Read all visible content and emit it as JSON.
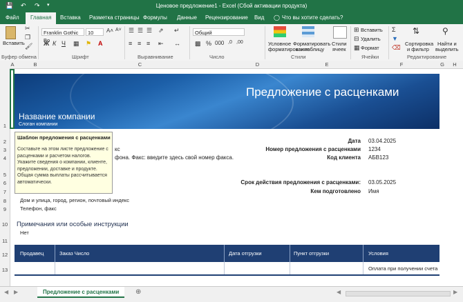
{
  "window": {
    "title": "Ценовое предложение1 - Excel (Сбой активации продукта)"
  },
  "tabs": {
    "file": "Файл",
    "home": "Главная",
    "insert": "Вставка",
    "layout": "Разметка страницы",
    "formulas": "Формулы",
    "data": "Данные",
    "review": "Рецензирование",
    "view": "Вид",
    "tellme": "Что вы хотите сделать?"
  },
  "ribbon": {
    "paste": "Вставить",
    "clipboard": "Буфер обмена",
    "font_name": "Franklin Gothic Bo",
    "font_size": "10",
    "font": "Шрифт",
    "alignment": "Выравнивание",
    "number_format": "Общий",
    "number": "Число",
    "conditional": "Условное",
    "conditional2": "форматирование",
    "format_table": "Форматировать",
    "format_table2": "как таблицу",
    "cell_styles": "Стили",
    "cell_styles2": "ячеек",
    "styles": "Стили",
    "insert": "Вставить",
    "delete": "Удалить",
    "format": "Формат",
    "cells": "Ячейки",
    "sort": "Сортировка",
    "sort2": "и фильтр",
    "find": "Найти и",
    "find2": "выделить",
    "editing": "Редактирование"
  },
  "columns": [
    "A",
    "B",
    "C",
    "D",
    "E",
    "F",
    "G",
    "H"
  ],
  "rows": [
    "1",
    "2",
    "3",
    "4",
    "5",
    "6",
    "7",
    "8",
    "9",
    "10",
    "11",
    "12",
    "13"
  ],
  "banner": {
    "title": "Предложение с расценками",
    "company": "Название компании",
    "slogan": "Слоган компании"
  },
  "tooltip": {
    "title": "Шаблон предложения с расценками",
    "body": "Составьте на этом листе предложение с расценками и расчетом налогов. Укажите сведения о компании, клиенте, предложении, доставке и продукте. Общая сумма выплаты рассчитывается автоматически."
  },
  "hidden_fragments": {
    "r3": "кс",
    "r4": "фона. Факс: введите здесь свой номер факса."
  },
  "details": {
    "date_label": "Дата",
    "date_value": "03.04.2025",
    "quote_no_label": "Номер предложения с расценками",
    "quote_no_value": "1234",
    "client_code_label": "Код клиента",
    "client_code_value": "АБВ123",
    "valid_label": "Срок действия предложения с расценками:",
    "valid_value": "03.05.2025",
    "prepared_label": "Кем подготовлено",
    "prepared_value": "Имя"
  },
  "address": {
    "line": "Дом и улица, город, регион, почтовый индекс",
    "phone": "Телефон, факс"
  },
  "notes": {
    "title": "Примечания или особые инструкции",
    "value": "Нет"
  },
  "table": {
    "headers": [
      "Продавец",
      "Заказ Число",
      "Дата отгрузки",
      "Пункт отгрузки",
      "Условия"
    ],
    "row1": [
      "",
      "",
      "",
      "",
      "Оплата при получении счета"
    ]
  },
  "sheet_tab": "Предложение с расценками",
  "colors": {
    "accent": "#217346",
    "table_header": "#1f3f73"
  }
}
